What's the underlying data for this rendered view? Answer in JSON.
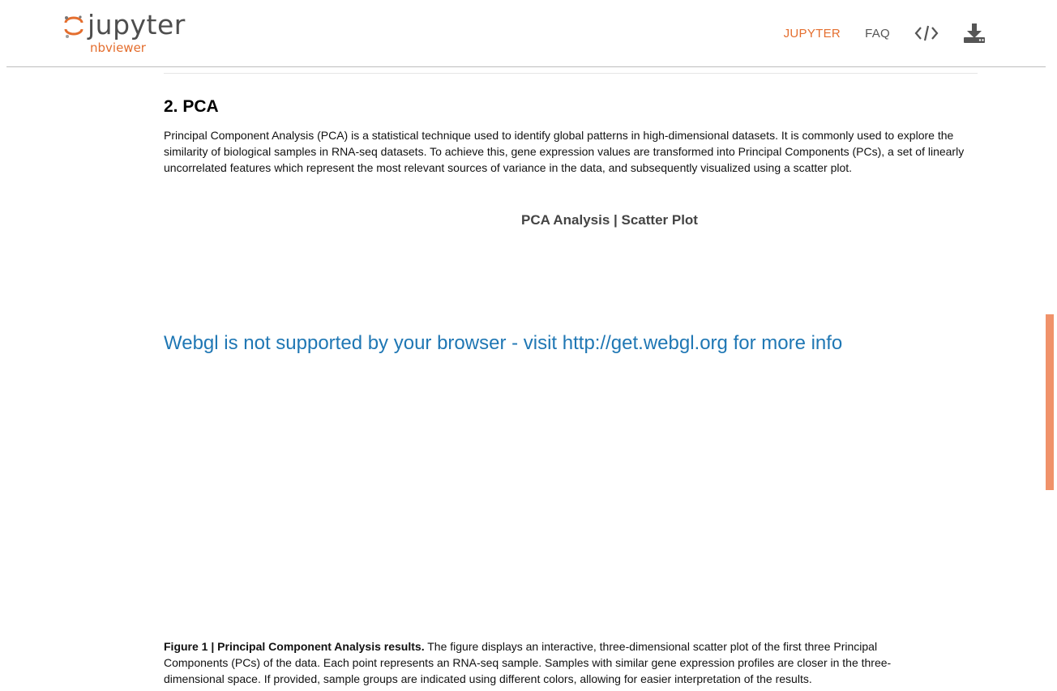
{
  "header": {
    "logo_word": "jupyter",
    "logo_sub": "nbviewer",
    "nav": {
      "jupyter": "JUPYTER",
      "faq": "FAQ"
    },
    "icons": [
      "code-icon",
      "download-icon"
    ]
  },
  "colors": {
    "accent": "#e46e2e",
    "link_blue": "#1f77b4",
    "scroll_thumb": "#f0926a"
  },
  "section": {
    "title": "2. PCA",
    "paragraph": "Principal Component Analysis (PCA) is a statistical technique used to identify global patterns in high-dimensional datasets. It is commonly used to explore the similarity of biological samples in RNA-seq datasets. To achieve this, gene expression values are transformed into Principal Components (PCs), a set of linearly uncorrelated features which represent the most relevant sources of variance in the data, and subsequently visualized using a scatter plot.",
    "plot_title": "PCA Analysis | Scatter Plot",
    "webgl_message": "Webgl is not supported by your browser - visit http://get.webgl.org for more info",
    "figure_label": "Figure 1 | Principal Component Analysis results.",
    "figure_text": " The figure displays an interactive, three-dimensional scatter plot of the first three Principal Components (PCs) of the data. Each point represents an RNA-seq sample. Samples with similar gene expression profiles are closer in the three-dimensional space. If provided, sample groups are indicated using different colors, allowing for easier interpretation of the results."
  }
}
